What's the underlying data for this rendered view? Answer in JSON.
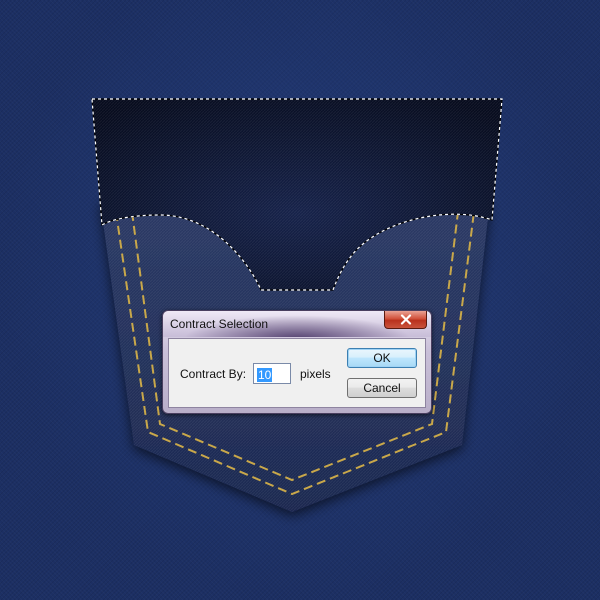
{
  "dialog": {
    "title": "Contract Selection",
    "field_label": "Contract By:",
    "field_value": "10",
    "unit": "pixels",
    "ok_label": "OK",
    "cancel_label": "Cancel",
    "close_icon": "close-icon"
  },
  "artwork": {
    "subject": "denim back pocket with dashed marching-ants selection",
    "colors": {
      "background": "#1c2f63",
      "pocket": "#1f2e55",
      "flap_selection": "#0d1530",
      "stitching": "#c9a84a",
      "selection_outline": "#ffffff"
    }
  }
}
